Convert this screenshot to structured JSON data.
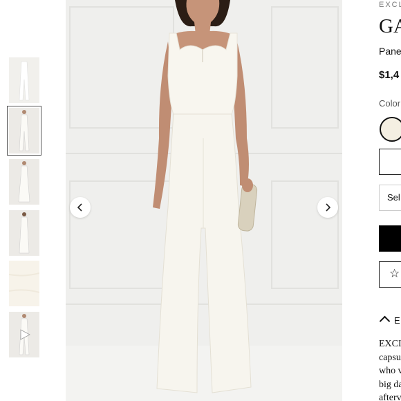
{
  "thumbnails": [
    {
      "name": "front-view"
    },
    {
      "name": "model-front",
      "selected": true
    },
    {
      "name": "model-side"
    },
    {
      "name": "model-back"
    },
    {
      "name": "fabric-detail"
    },
    {
      "name": "video"
    }
  ],
  "product": {
    "brand": "EXCL",
    "title": "GA",
    "description": "Pane",
    "price": "$1,4",
    "color_label": "Color",
    "swatch_color": "#f4efe2",
    "size_select": "Sel",
    "wishlist_icon": "☆",
    "editors_notes_heading": "E",
    "body_lines": [
      "EXCI",
      "capsu",
      "who v",
      "big da",
      "afterv"
    ]
  },
  "gallery": {
    "prev_icon": "chevron-left-icon",
    "next_icon": "chevron-right-icon"
  }
}
